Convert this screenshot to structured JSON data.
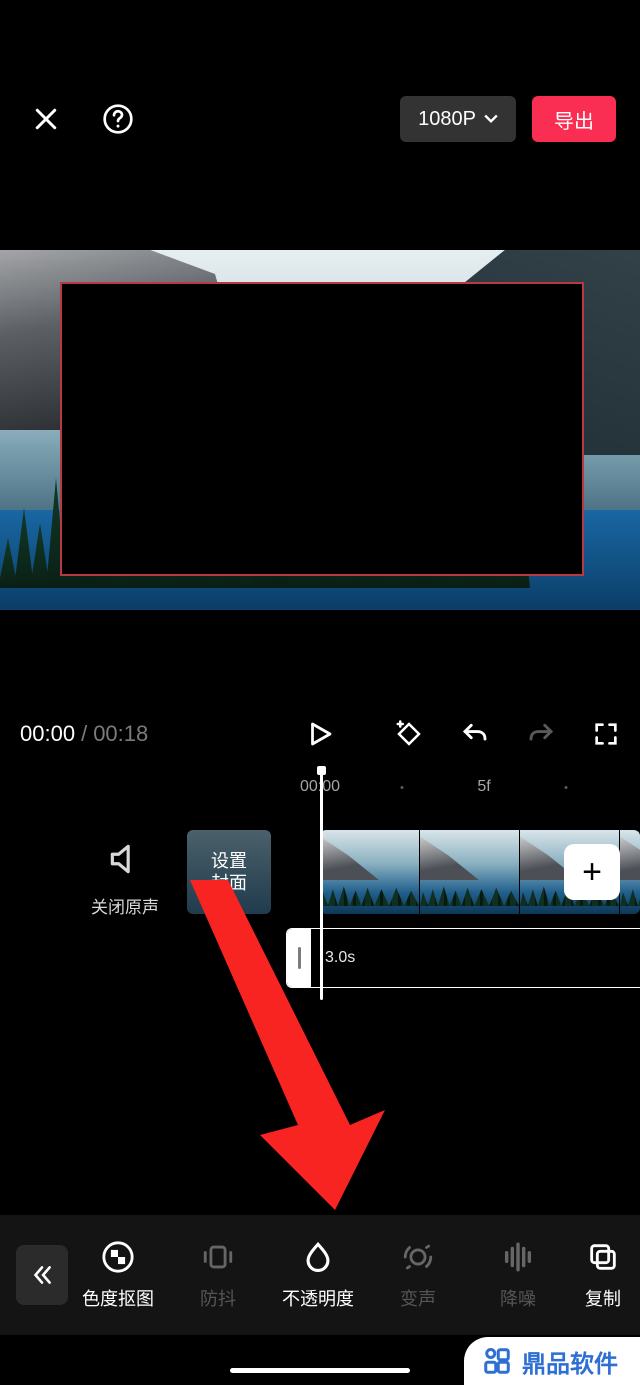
{
  "header": {
    "resolution_label": "1080P",
    "export_label": "导出"
  },
  "playback": {
    "current": "00:00",
    "separator": "/",
    "total": "00:18"
  },
  "ruler": {
    "start": "00:00",
    "mark": "5f"
  },
  "timeline": {
    "mute_label": "关闭原声",
    "cover_label": "设置\n封面",
    "second_clip_duration": "3.0s",
    "add_label": "+"
  },
  "tools": {
    "chroma": "色度抠图",
    "stabilize": "防抖",
    "opacity": "不透明度",
    "voice": "变声",
    "noise": "降噪",
    "copy": "复制"
  },
  "watermark": "鼎品软件"
}
